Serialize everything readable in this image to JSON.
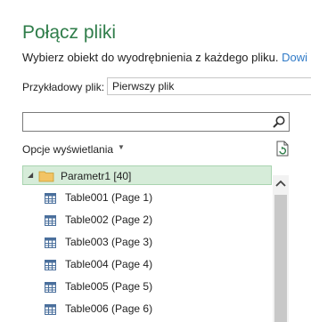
{
  "dialog": {
    "title": "Połącz pliki",
    "subtitle": "Wybierz obiekt do wyodrębnienia z każdego pliku. ",
    "subtitle_link": "Dowi"
  },
  "sample_file": {
    "label": "Przykładowy plik:",
    "selected": "Pierwszy plik"
  },
  "search": {
    "value": "",
    "placeholder": ""
  },
  "display_options": {
    "label": "Opcje wyświetlania"
  },
  "tree": {
    "folder": {
      "label": "Parametr1 [40]"
    },
    "items": [
      {
        "label": "Table001 (Page 1)"
      },
      {
        "label": "Table002 (Page 2)"
      },
      {
        "label": "Table003 (Page 3)"
      },
      {
        "label": "Table004 (Page 4)"
      },
      {
        "label": "Table005 (Page 5)"
      },
      {
        "label": "Table006 (Page 6)"
      }
    ]
  },
  "colors": {
    "title": "#2f7d4a",
    "link": "#2e79c7",
    "selection_bg": "#d6ecd9",
    "selection_border": "#a9d4b0"
  }
}
